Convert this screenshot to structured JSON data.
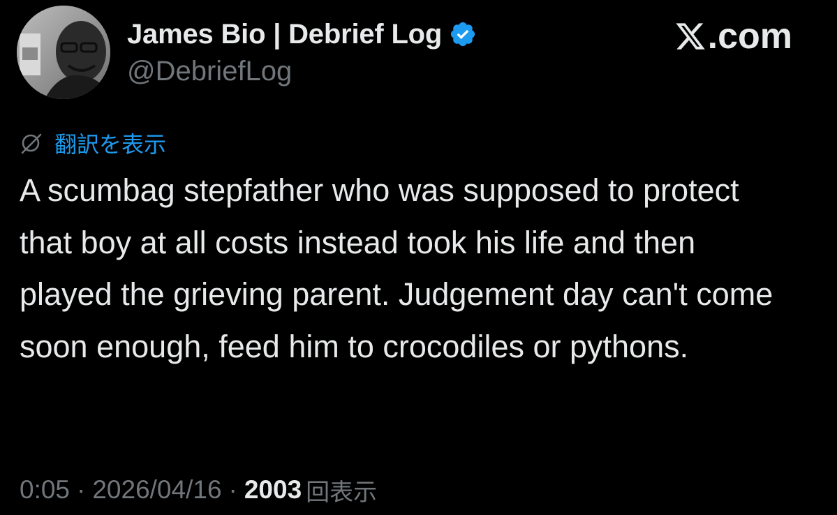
{
  "author": {
    "display_name": "James Bio | Debrief Log",
    "handle": "@DebriefLog",
    "verified": true,
    "verified_color": "#1d9bf0"
  },
  "site_logo": {
    "glyph": "𝕏",
    "text": ".com"
  },
  "translate": {
    "icon": "globe-slash-icon",
    "label": "翻訳を表示"
  },
  "tweet": {
    "text": "A scumbag stepfather who was supposed to protect that boy at all costs instead took his life and then played the grieving parent. Judgement day can't come soon enough, feed him to crocodiles or pythons."
  },
  "meta": {
    "time": "0:05",
    "separator": "·",
    "date": "2026/04/16",
    "views_count": "2003",
    "views_label": "回表示"
  },
  "colors": {
    "background": "#000000",
    "primary_text": "#e7e9ea",
    "secondary_text": "#71767b",
    "accent": "#1d9bf0"
  }
}
